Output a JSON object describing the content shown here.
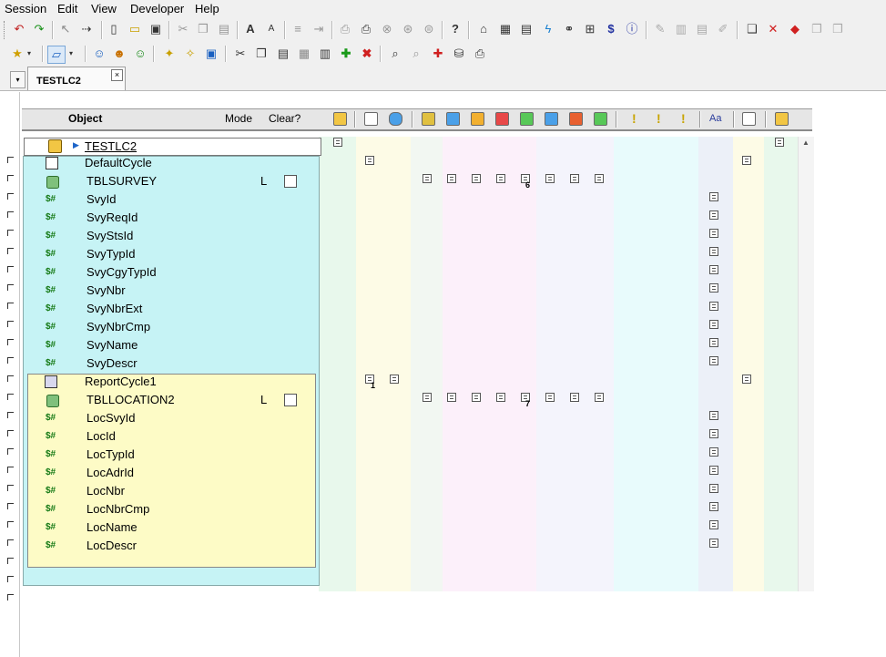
{
  "menu": [
    "Session",
    "Edit",
    "View",
    "Developer",
    "Help"
  ],
  "tab": {
    "label": "TESTLC2",
    "close_glyph": "×",
    "dropdown_glyph": "▾"
  },
  "headers": {
    "object": "Object",
    "mode": "Mode",
    "clear": "Clear?",
    "aa": "Aa"
  },
  "tree": {
    "root": "TESTLC2",
    "rows": [
      {
        "label": "DefaultCycle",
        "icon": "cycle-icon"
      },
      {
        "label": "TBLSURVEY",
        "icon": "table-icon",
        "mode": "L",
        "clear": true
      },
      {
        "label": "SvyId",
        "icon": "field-icon",
        "prefix": "$#"
      },
      {
        "label": "SvyReqId",
        "icon": "field-icon",
        "prefix": "$#"
      },
      {
        "label": "SvyStsId",
        "icon": "field-icon",
        "prefix": "$#"
      },
      {
        "label": "SvyTypId",
        "icon": "field-icon",
        "prefix": "$#"
      },
      {
        "label": "SvyCgyTypId",
        "icon": "field-icon",
        "prefix": "$#"
      },
      {
        "label": "SvyNbr",
        "icon": "field-icon",
        "prefix": "$#"
      },
      {
        "label": "SvyNbrExt",
        "icon": "field-icon",
        "prefix": "$#"
      },
      {
        "label": "SvyNbrCmp",
        "icon": "field-icon",
        "prefix": "$#"
      },
      {
        "label": "SvyName",
        "icon": "field-icon",
        "prefix": "$#"
      },
      {
        "label": "SvyDescr",
        "icon": "field-icon",
        "prefix": "$#"
      },
      {
        "label": "ReportCycle1",
        "icon": "report-cycle-icon"
      },
      {
        "label": "TBLLOCATION2",
        "icon": "table-icon",
        "mode": "L",
        "clear": true
      },
      {
        "label": "LocSvyId",
        "icon": "field-icon",
        "prefix": "$#"
      },
      {
        "label": "LocId",
        "icon": "field-icon",
        "prefix": "$#"
      },
      {
        "label": "LocTypId",
        "icon": "field-icon",
        "prefix": "$#"
      },
      {
        "label": "LocAdrId",
        "icon": "field-icon",
        "prefix": "$#"
      },
      {
        "label": "LocNbr",
        "icon": "field-icon",
        "prefix": "$#"
      },
      {
        "label": "LocNbrCmp",
        "icon": "field-icon",
        "prefix": "$#"
      },
      {
        "label": "LocName",
        "icon": "field-icon",
        "prefix": "$#"
      },
      {
        "label": "LocDescr",
        "icon": "field-icon",
        "prefix": "$#"
      }
    ]
  },
  "markers": {
    "row_6_label": "6",
    "row_7_label": "7",
    "row_1_label": "1"
  },
  "toolbar_icons": [
    "undo-icon",
    "redo-icon",
    "cut-select-icon",
    "move-icon",
    "new-icon",
    "open-icon",
    "save-icon",
    "scissors-icon",
    "copy-icon",
    "paste-icon",
    "font-larger-icon",
    "font-smaller-icon",
    "properties-icon",
    "help-icon"
  ]
}
